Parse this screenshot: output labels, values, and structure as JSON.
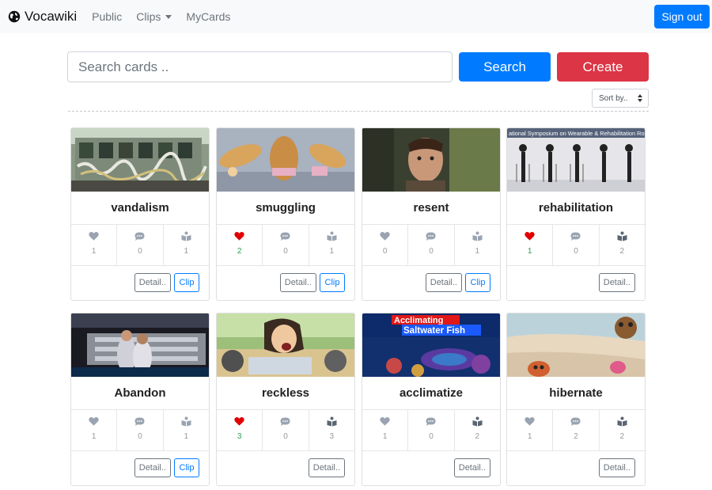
{
  "nav": {
    "brand": "Vocawiki",
    "links": {
      "public": "Public",
      "clips": "Clips",
      "mycards": "MyCards"
    },
    "signout": "Sign out"
  },
  "search": {
    "placeholder": "Search cards ..",
    "search_label": "Search",
    "create_label": "Create"
  },
  "sort": {
    "label": "Sort by.."
  },
  "colors": {
    "primary": "#007bff",
    "danger": "#dc3545",
    "liked": "#e00000",
    "icon_gray": "#9aa4b1",
    "icon_dark": "#5a6570"
  },
  "card_actions": {
    "detail_label": "Detail..",
    "clip_label": "Clip"
  },
  "cards": [
    {
      "word": "vandalism",
      "likes": "1",
      "comments": "0",
      "clips": "1",
      "liked": false,
      "clipped_dark": false,
      "has_clip_button": true
    },
    {
      "word": "smuggling",
      "likes": "2",
      "comments": "0",
      "clips": "1",
      "liked": true,
      "clipped_dark": false,
      "has_clip_button": true
    },
    {
      "word": "resent",
      "likes": "0",
      "comments": "0",
      "clips": "1",
      "liked": false,
      "clipped_dark": false,
      "has_clip_button": true
    },
    {
      "word": "rehabilitation",
      "likes": "1",
      "comments": "0",
      "clips": "2",
      "liked": true,
      "clipped_dark": true,
      "has_clip_button": false,
      "image_caption": "ational Symposium on Wearable & Rehabilitation Ro"
    },
    {
      "word": "Abandon",
      "likes": "1",
      "comments": "0",
      "clips": "1",
      "liked": false,
      "clipped_dark": false,
      "has_clip_button": true
    },
    {
      "word": "reckless",
      "likes": "3",
      "comments": "0",
      "clips": "3",
      "liked": true,
      "clipped_dark": true,
      "has_clip_button": false
    },
    {
      "word": "acclimatize",
      "likes": "1",
      "comments": "0",
      "clips": "2",
      "liked": false,
      "clipped_dark": true,
      "has_clip_button": false,
      "image_caption_1": "Acclimating",
      "image_caption_2": "Saltwater Fish"
    },
    {
      "word": "hibernate",
      "likes": "1",
      "comments": "2",
      "clips": "2",
      "liked": false,
      "clipped_dark": true,
      "has_clip_button": false
    }
  ]
}
